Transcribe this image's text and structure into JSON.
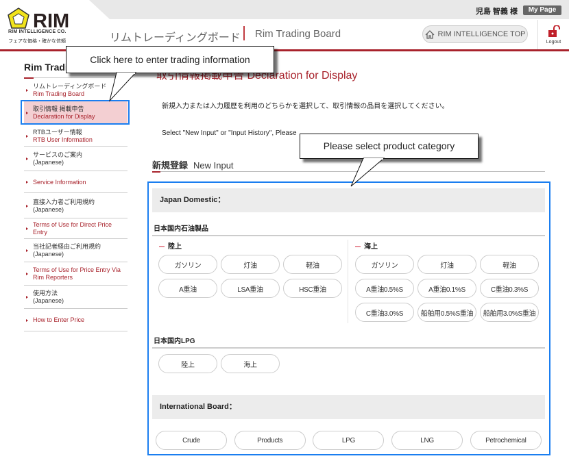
{
  "header": {
    "user_name": "児島 智義 様",
    "mypage_label": "My Page",
    "brand_name": "RIM INTELLIGENCE CO.",
    "brand_tagline": "フェアな価格・確かな信頼",
    "logo_text": "RIM",
    "title_jp": "リムトレーディングボード",
    "title_en": "Rim Trading Board",
    "top_button": "RIM INTELLIGENCE TOP",
    "logout_label": "Logout",
    "accent_color": "#a8222b"
  },
  "sidebar": {
    "title": "Rim Trading Board",
    "items": [
      {
        "jp": "リムトレーディングボード",
        "en": "Rim Trading Board"
      },
      {
        "jp": "取引情報 掲載申告",
        "en": "Declaration for Display",
        "active": true
      },
      {
        "jp": "RTBユーザー情報",
        "en": "RTB User Information"
      },
      {
        "jp": "サービスのご案内",
        "jp2": "(Japanese)"
      },
      {
        "en": "Service Information"
      },
      {
        "jp": "直接入力者ご利用規約",
        "jp2": "(Japanese)"
      },
      {
        "en": "Terms of Use for Direct Price Entry"
      },
      {
        "jp": "当社記者経由ご利用規約",
        "jp2": "(Japanese)"
      },
      {
        "en": "Terms of Use for Price Entry Via",
        "en2": "Rim Reporters"
      },
      {
        "jp": "使用方法",
        "jp2": "(Japanese)"
      },
      {
        "en": "How to Enter Price"
      }
    ]
  },
  "main": {
    "heading_jp": "取引情報掲載申告",
    "heading_en": "Declaration for Display",
    "intro_jp": "新規入力または入力履歴を利用のどちらかを選択して、取引情報の品目を選択してください。",
    "intro_en": "Select \"New Input\" or \"Input History\", Please",
    "tab_jp": "新規登録",
    "tab_en": "New Input",
    "japan_domestic": "Japan Domestic：",
    "petroleum_title": "日本国内石油製品",
    "land_label": "陸上",
    "sea_label": "海上",
    "land_products": [
      "ガソリン",
      "灯油",
      "軽油",
      "A重油",
      "LSA重油",
      "HSC重油"
    ],
    "sea_products": [
      "ガソリン",
      "灯油",
      "軽油",
      "A重油0.5%S",
      "A重油0.1%S",
      "C重油0.3%S",
      "C重油3.0%S",
      "船舶用0.5%S重油",
      "船舶用3.0%S重油"
    ],
    "lpg_title": "日本国内LPG",
    "lpg_products": [
      "陸上",
      "海上"
    ],
    "international": "International Board：",
    "international_products": [
      "Crude",
      "Products",
      "LPG",
      "LNG",
      "Petrochemical"
    ]
  },
  "callouts": {
    "first": "Click here to enter trading information",
    "second": "Please select product category"
  }
}
